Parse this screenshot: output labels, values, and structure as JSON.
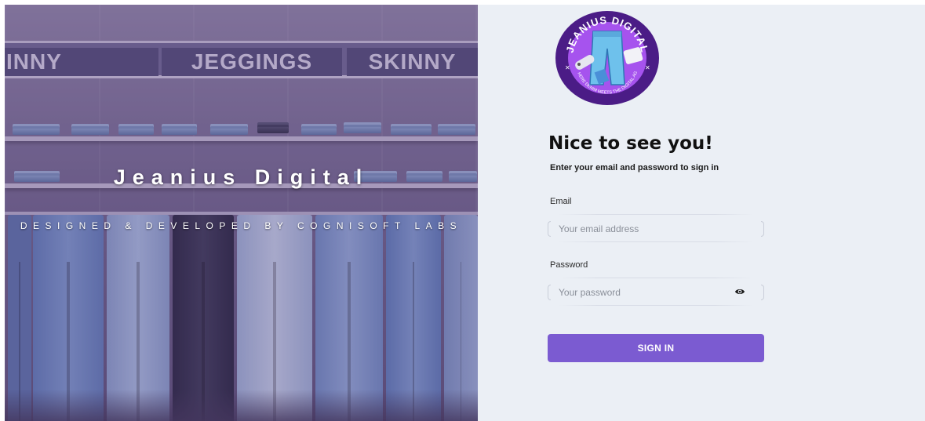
{
  "hero": {
    "signs": [
      "INNY",
      "JEGGINGS",
      "SKINNY"
    ],
    "title": "Jeanius Digital",
    "subtitle": "DESIGNED & DEVELOPED BY COGNISOFT LABS"
  },
  "logo": {
    "icon": "jeanius-digital-logo",
    "ring_text": "JEANIUS DIGITAL",
    "tagline": "WHERE DENIM MEETS THE DIGITAL AGE"
  },
  "signin": {
    "heading": "Nice to see you!",
    "subheading": "Enter your email and password to sign in",
    "email_label": "Email",
    "email_placeholder": "Your email address",
    "email_value": "",
    "password_label": "Password",
    "password_placeholder": "Your password",
    "password_value": "",
    "eye_icon": "eye-icon",
    "button_label": "SIGN IN"
  },
  "colors": {
    "accent": "#7b5bd1",
    "panel_bg": "#ebeff5",
    "logo_ring": "#4b1c86",
    "logo_inner": "#a653ee"
  }
}
